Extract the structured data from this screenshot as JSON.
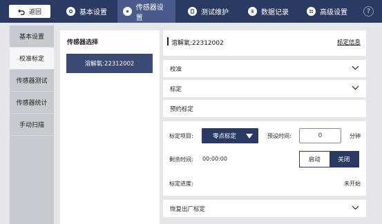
{
  "topbar": {
    "back_label": "返回",
    "tabs": [
      {
        "label": "基本设置",
        "icon": "gear-icon"
      },
      {
        "label": "传感器设置",
        "icon": "sensor-icon",
        "active": true
      },
      {
        "label": "测试维护",
        "icon": "document-icon"
      },
      {
        "label": "数据记录",
        "icon": "list-icon"
      },
      {
        "label": "高级设置",
        "icon": "grid-icon"
      }
    ],
    "help_label": "?"
  },
  "leftnav": {
    "items": [
      {
        "label": "基本设置"
      },
      {
        "label": "校准标定",
        "active": true
      },
      {
        "label": "传感器测试"
      },
      {
        "label": "传感器统计"
      },
      {
        "label": "手动扫描"
      }
    ]
  },
  "sensor_list": {
    "title": "传感器选择",
    "items": [
      "溶解氧:22312002"
    ]
  },
  "detail": {
    "title": "溶解氧:22312002",
    "info_link": "标定信息",
    "sections": {
      "calibrate": "校准",
      "standardize": "标定",
      "scheduled": "预约标定",
      "restore": "恢复出厂标定"
    },
    "calib": {
      "item_label": "标定项目:",
      "item_value": "零点标定",
      "preset_label": "预设时间:",
      "preset_value": "0",
      "preset_unit": "分钟",
      "remaining_label": "剩余时间:",
      "remaining_value": "00:00:00",
      "start_label": "启动",
      "stop_label": "关闭",
      "progress_label": "标定进度:",
      "progress_status": "未开始"
    }
  },
  "colors": {
    "topbar": "#2b3a63",
    "active_tab": "#4a5a8a",
    "accent": "#3a4a74"
  }
}
